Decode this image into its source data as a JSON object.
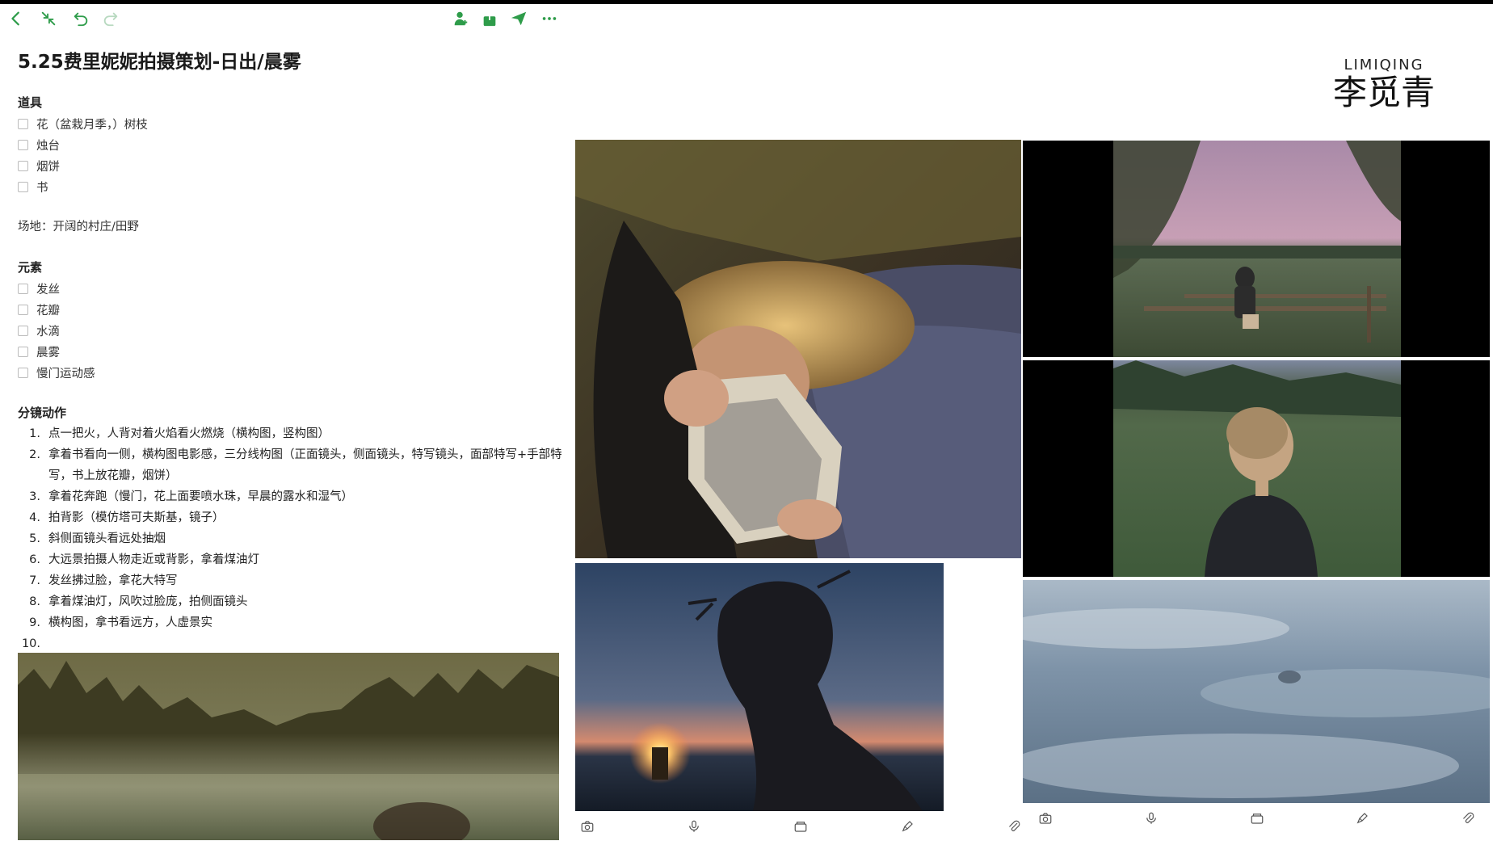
{
  "toolbar": {
    "icons": [
      "back-icon",
      "collapse-icon",
      "undo-icon",
      "redo-icon",
      "add-collaborator-icon",
      "share-icon",
      "send-icon",
      "more-icon"
    ]
  },
  "document": {
    "title": "5.25费里妮妮拍摄策划-日出/晨雾",
    "props_heading": "道具",
    "props": [
      "花（盆栽月季，）树枝",
      "烛台",
      "烟饼",
      "书"
    ],
    "venue": "场地：开阔的村庄/田野",
    "elements_heading": "元素",
    "elements": [
      "发丝",
      "花瓣",
      "水滴",
      "晨雾",
      "慢门运动感"
    ],
    "shots_heading": "分镜动作",
    "shots": [
      {
        "num": "1.",
        "text": "点一把火，人背对着火焰看火燃烧（横构图，竖构图）"
      },
      {
        "num": "2.",
        "text": "拿着书看向一侧，横构图电影感，三分线构图（正面镜头，侧面镜头，特写镜头，面部特写+手部特写，书上放花瓣，烟饼）"
      },
      {
        "num": "3.",
        "text": "拿着花奔跑（慢门，花上面要喷水珠，早晨的露水和湿气）"
      },
      {
        "num": "4.",
        "text": "拍背影（模仿塔可夫斯基，镜子）"
      },
      {
        "num": "5.",
        "text": "斜侧面镜头看远处抽烟"
      },
      {
        "num": "6.",
        "text": "大远景拍摄人物走近或背影，拿着煤油灯"
      },
      {
        "num": "7.",
        "text": "发丝拂过脸，拿花大特写"
      },
      {
        "num": "8.",
        "text": "拿着煤油灯，风吹过脸庞，拍侧面镜头"
      },
      {
        "num": "9.",
        "text": "横构图，拿书看远方，人虚景实"
      },
      {
        "num": "10.",
        "text": ""
      }
    ]
  },
  "brand": {
    "latin": "LIMIQING",
    "chinese": "李觅青"
  },
  "bottom_toolbar": {
    "icons": [
      "camera-icon",
      "microphone-icon",
      "folder-icon",
      "pen-icon",
      "paperclip-icon"
    ]
  },
  "colors": {
    "accent": "#2e9c4a"
  }
}
